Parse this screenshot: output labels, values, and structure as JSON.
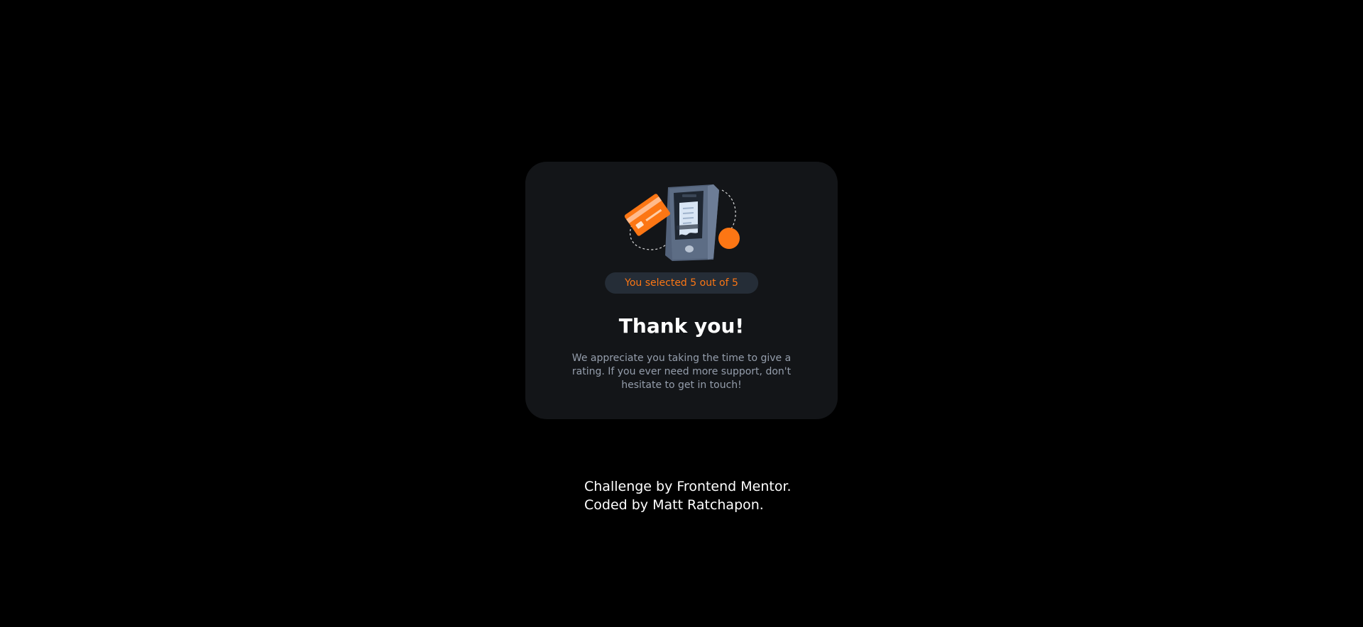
{
  "card": {
    "rating_pill": "You selected 5 out of 5",
    "title": "Thank you!",
    "message": "We appreciate you taking the time to give a rating. If you ever need more support, don't hesitate to get in touch!"
  },
  "footer": {
    "line1": "Challenge by Frontend Mentor.",
    "line2": "Coded by Matt Ratchapon."
  },
  "colors": {
    "background": "#000000",
    "card": "#131518",
    "accent": "#fc7614",
    "pill_bg": "#252d37",
    "muted_text": "#959eac",
    "white": "#ffffff"
  },
  "icons": {
    "illustration": "phone-receipt-card-illustration"
  }
}
